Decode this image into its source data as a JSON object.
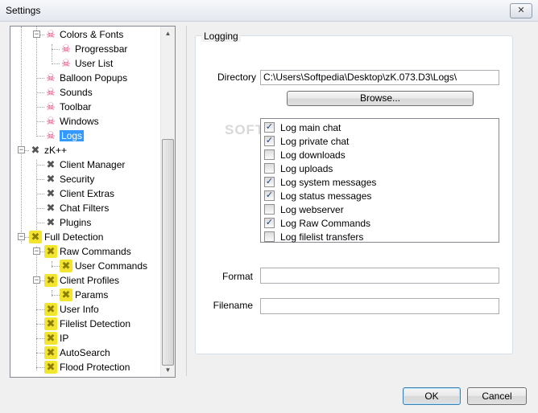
{
  "window": {
    "title": "Settings",
    "close_glyph": "✕"
  },
  "tree": {
    "scroll_up": "▲",
    "scroll_down": "▼",
    "items": [
      {
        "label": "Colors & Fonts",
        "icon": "skull-icon",
        "expander": "−"
      },
      {
        "label": "Progressbar",
        "icon": "skull-icon"
      },
      {
        "label": "User List",
        "icon": "skull-icon"
      },
      {
        "label": "Balloon Popups",
        "icon": "skull-icon"
      },
      {
        "label": "Sounds",
        "icon": "skull-icon"
      },
      {
        "label": "Toolbar",
        "icon": "skull-icon"
      },
      {
        "label": "Windows",
        "icon": "skull-icon"
      },
      {
        "label": "Logs",
        "icon": "skull-icon",
        "selected": true
      },
      {
        "label": "zK++",
        "icon": "crossed-tools-icon",
        "expander": "−"
      },
      {
        "label": "Client Manager",
        "icon": "crossed-tools-icon"
      },
      {
        "label": "Security",
        "icon": "crossed-tools-icon"
      },
      {
        "label": "Client Extras",
        "icon": "crossed-tools-icon"
      },
      {
        "label": "Chat Filters",
        "icon": "crossed-tools-icon"
      },
      {
        "label": "Plugins",
        "icon": "crossed-tools-icon"
      },
      {
        "label": "Full Detection",
        "icon": "yellow-cross-icon",
        "expander": "−"
      },
      {
        "label": "Raw Commands",
        "icon": "yellow-cross-icon",
        "expander": "−"
      },
      {
        "label": "User Commands",
        "icon": "yellow-cross-icon"
      },
      {
        "label": "Client Profiles",
        "icon": "yellow-cross-icon",
        "expander": "−"
      },
      {
        "label": "Params",
        "icon": "yellow-cross-icon"
      },
      {
        "label": "User Info",
        "icon": "yellow-cross-icon"
      },
      {
        "label": "Filelist Detection",
        "icon": "yellow-cross-icon"
      },
      {
        "label": "IP",
        "icon": "yellow-cross-icon"
      },
      {
        "label": "AutoSearch",
        "icon": "yellow-cross-icon"
      },
      {
        "label": "Flood Protection",
        "icon": "yellow-cross-icon"
      }
    ]
  },
  "logging": {
    "group_title": "Logging",
    "directory_label": "Directory",
    "directory_value": "C:\\Users\\Softpedia\\Desktop\\zK.073.D3\\Logs\\",
    "browse_label": "Browse...",
    "options": [
      {
        "label": "Log main chat",
        "checked": true
      },
      {
        "label": "Log private chat",
        "checked": true
      },
      {
        "label": "Log downloads",
        "checked": false
      },
      {
        "label": "Log uploads",
        "checked": false
      },
      {
        "label": "Log system messages",
        "checked": true
      },
      {
        "label": "Log status messages",
        "checked": true
      },
      {
        "label": "Log webserver",
        "checked": false
      },
      {
        "label": "Log Raw Commands",
        "checked": true
      },
      {
        "label": "Log filelist transfers",
        "checked": false
      }
    ],
    "format_label": "Format",
    "format_value": "",
    "filename_label": "Filename",
    "filename_value": "",
    "check_glyph": "✓"
  },
  "watermark": "SOFT",
  "buttons": {
    "ok": "OK",
    "cancel": "Cancel"
  }
}
